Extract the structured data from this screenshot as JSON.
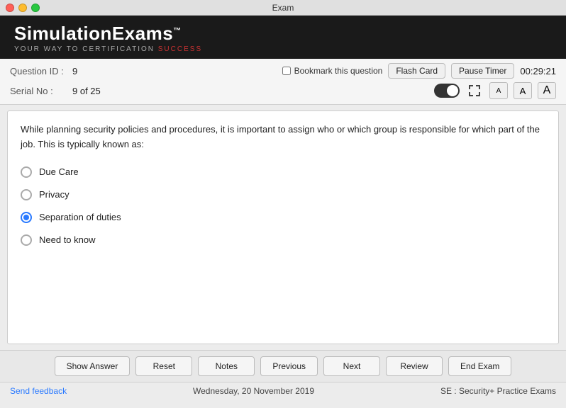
{
  "titlebar": {
    "title": "Exam"
  },
  "brand": {
    "name": "SimulationExams",
    "tm": "™",
    "tagline_normal": "YOUR WAY TO CERTIFICATION ",
    "tagline_highlight": "SUCCESS"
  },
  "meta": {
    "question_id_label": "Question ID :",
    "question_id_value": "9",
    "serial_no_label": "Serial No :",
    "serial_no_value": "9 of 25",
    "bookmark_label": "Bookmark this question",
    "flash_card_label": "Flash Card",
    "pause_timer_label": "Pause Timer",
    "timer_value": "00:29:21",
    "font_btns": [
      "A",
      "A",
      "A"
    ]
  },
  "question": {
    "text": "While planning security policies and procedures, it is important to assign who or which group is responsible for which part of the job. This is typically known as:"
  },
  "options": [
    {
      "id": "opt1",
      "label": "Due Care",
      "selected": false
    },
    {
      "id": "opt2",
      "label": "Privacy",
      "selected": false
    },
    {
      "id": "opt3",
      "label": "Separation of duties",
      "selected": true
    },
    {
      "id": "opt4",
      "label": "Need to know",
      "selected": false
    }
  ],
  "actions": {
    "show_answer": "Show Answer",
    "reset": "Reset",
    "notes": "Notes",
    "previous": "Previous",
    "next": "Next",
    "review": "Review",
    "end_exam": "End Exam"
  },
  "footer": {
    "feedback_label": "Send feedback",
    "date": "Wednesday, 20 November 2019",
    "product": "SE : Security+ Practice Exams"
  }
}
